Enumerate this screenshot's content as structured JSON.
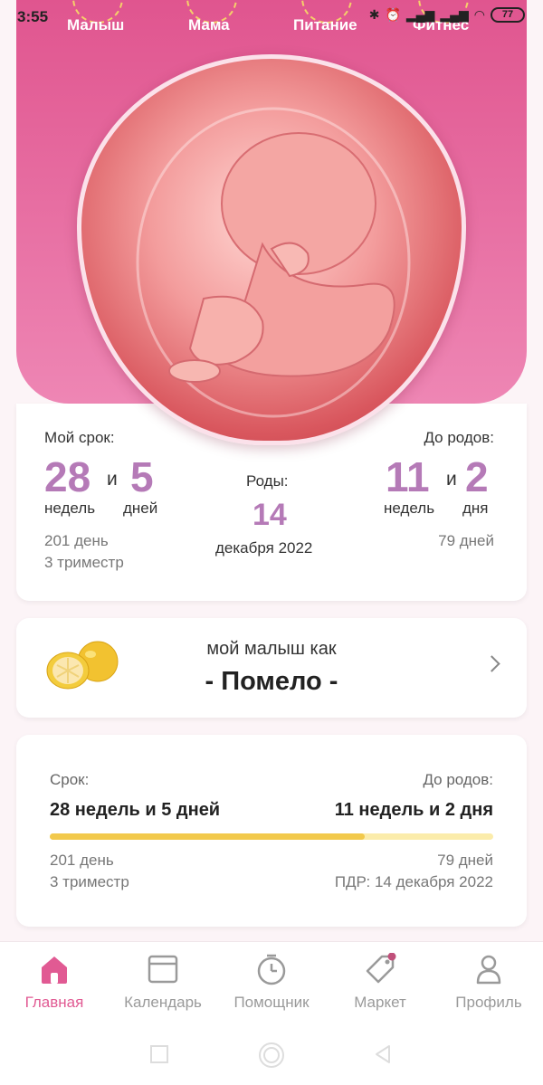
{
  "status_bar": {
    "time": "3:55",
    "battery": "77"
  },
  "top_tabs": [
    "Малыш",
    "Мама",
    "Питание",
    "Фитнес"
  ],
  "term_card": {
    "my_term_label": "Мой срок:",
    "weeks": "28",
    "conj": "и",
    "days": "5",
    "weeks_word": "недель",
    "days_word": "дней",
    "day_count": "201 день",
    "trimester": "3 триместр",
    "birth_label": "Роды:",
    "birth_day": "14",
    "birth_month_year": "декабря 2022",
    "until_label": "До родов:",
    "until_weeks": "11",
    "until_conj": "и",
    "until_days": "2",
    "until_weeks_word": "недель",
    "until_days_word": "дня",
    "until_day_count": "79 дней"
  },
  "fruit_card": {
    "caption": "мой малыш как",
    "fruit": "- Помело -"
  },
  "progress_card": {
    "term_label": "Срок:",
    "term_value": "28 недель и 5 дней",
    "until_label": "До родов:",
    "until_value": "11 недель и 2 дня",
    "progress_fraction": 0.71,
    "day_count": "201 день",
    "trimester": "3 триместр",
    "until_day_count": "79 дней",
    "due_date": "ПДР: 14 декабря 2022"
  },
  "bottom_nav": [
    {
      "label": "Главная",
      "icon": "home-icon",
      "active": true
    },
    {
      "label": "Календарь",
      "icon": "calendar-icon",
      "active": false
    },
    {
      "label": "Помощник",
      "icon": "timer-icon",
      "active": false
    },
    {
      "label": "Маркет",
      "icon": "tag-icon",
      "active": false
    },
    {
      "label": "Профиль",
      "icon": "person-icon",
      "active": false
    }
  ],
  "colors": {
    "accent": "#e15a93",
    "number": "#b57ab7",
    "progress": "#f2c94c"
  }
}
